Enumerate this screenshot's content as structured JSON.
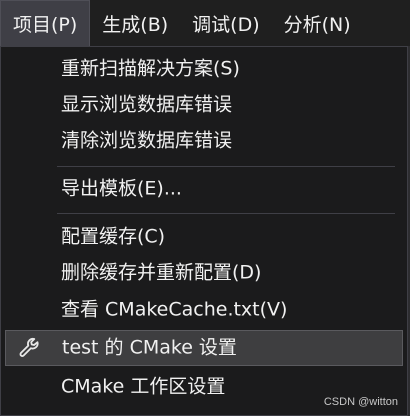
{
  "menubar": {
    "items": [
      {
        "label": "项目(P)"
      },
      {
        "label": "生成(B)"
      },
      {
        "label": "调试(D)"
      },
      {
        "label": "分析(N)"
      }
    ]
  },
  "dropdown": {
    "items": [
      {
        "label": "重新扫描解决方案(S)"
      },
      {
        "label": "显示浏览数据库错误"
      },
      {
        "label": "清除浏览数据库错误"
      },
      {
        "label": "导出模板(E)..."
      },
      {
        "label": "配置缓存(C)"
      },
      {
        "label": "删除缓存并重新配置(D)"
      },
      {
        "label": "查看 CMakeCache.txt(V)"
      },
      {
        "label": "test 的 CMake 设置",
        "icon": "wrench-icon"
      },
      {
        "label": "CMake 工作区设置"
      }
    ]
  },
  "watermark": "CSDN @witton"
}
